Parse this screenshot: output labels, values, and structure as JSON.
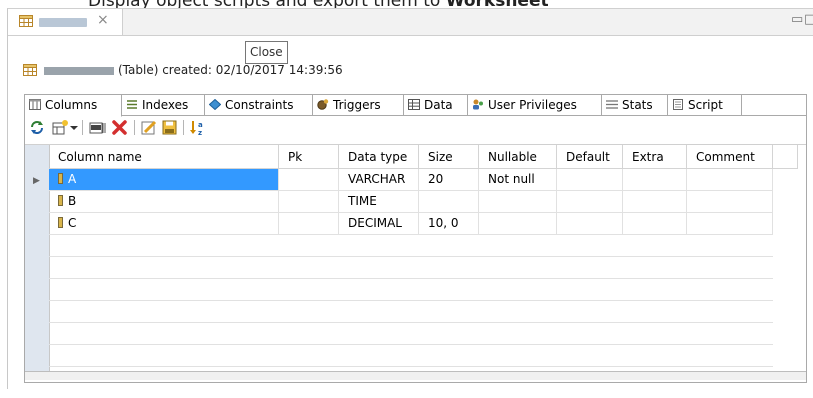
{
  "heading": {
    "prefix": "Display object scripts and export them to ",
    "emphasis": "Worksheet"
  },
  "editor_tab": {
    "close_glyph": "×"
  },
  "window_buttons": {
    "minimize": "▭",
    "maximize": "□"
  },
  "tooltip": {
    "text": "Close"
  },
  "info": {
    "text": "(Table) created: 02/10/2017 14:39:56"
  },
  "tabs": [
    {
      "label": "Columns",
      "icon": "columns-icon"
    },
    {
      "label": "Indexes",
      "icon": "indexes-icon"
    },
    {
      "label": "Constraints",
      "icon": "constraints-icon"
    },
    {
      "label": "Triggers",
      "icon": "triggers-icon"
    },
    {
      "label": "Data",
      "icon": "data-icon"
    },
    {
      "label": "User Privileges",
      "icon": "user-privileges-icon"
    },
    {
      "label": "Stats",
      "icon": "stats-icon"
    },
    {
      "label": "Script",
      "icon": "script-icon"
    }
  ],
  "toolbar": {
    "buttons": [
      "refresh-icon",
      "add-column-icon",
      "dropdown-arrow-icon",
      "ref-icon",
      "delete-icon",
      "edit-icon",
      "save-icon",
      "sort-az-icon"
    ]
  },
  "grid": {
    "headers": [
      "Column name",
      "Pk",
      "Data type",
      "Size",
      "Nullable",
      "Default",
      "Extra",
      "Comment"
    ],
    "rows": [
      [
        "A",
        "",
        "VARCHAR",
        "20",
        "Not null",
        "",
        "",
        ""
      ],
      [
        "B",
        "",
        "TIME",
        "",
        "",
        "",
        "",
        ""
      ],
      [
        "C",
        "",
        "DECIMAL",
        "10, 0",
        "",
        "",
        "",
        ""
      ]
    ],
    "selected_row": 0
  },
  "colors": {
    "selection": "#3399ff",
    "rowheader": "#dfe6ef",
    "accent": "#2255bb"
  }
}
